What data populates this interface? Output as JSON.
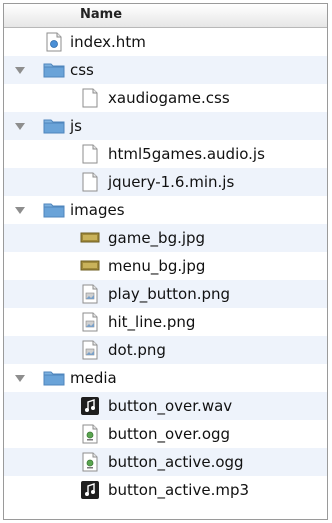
{
  "header": {
    "name_label": "Name"
  },
  "items": [
    {
      "label": "index.htm",
      "kind": "html",
      "level": 0,
      "expanded": false
    },
    {
      "label": "css",
      "kind": "folder",
      "level": 0,
      "expanded": true
    },
    {
      "label": "xaudiogame.css",
      "kind": "doc",
      "level": 1,
      "expanded": false
    },
    {
      "label": "js",
      "kind": "folder",
      "level": 0,
      "expanded": true
    },
    {
      "label": "html5games.audio.js",
      "kind": "doc",
      "level": 1,
      "expanded": false
    },
    {
      "label": "jquery-1.6.min.js",
      "kind": "doc",
      "level": 1,
      "expanded": false
    },
    {
      "label": "images",
      "kind": "folder",
      "level": 0,
      "expanded": true
    },
    {
      "label": "game_bg.jpg",
      "kind": "jpg",
      "level": 1,
      "expanded": false
    },
    {
      "label": "menu_bg.jpg",
      "kind": "jpg",
      "level": 1,
      "expanded": false
    },
    {
      "label": "play_button.png",
      "kind": "png",
      "level": 1,
      "expanded": false
    },
    {
      "label": "hit_line.png",
      "kind": "png",
      "level": 1,
      "expanded": false
    },
    {
      "label": "dot.png",
      "kind": "png",
      "level": 1,
      "expanded": false
    },
    {
      "label": "media",
      "kind": "folder",
      "level": 0,
      "expanded": true
    },
    {
      "label": "button_over.wav",
      "kind": "audio",
      "level": 1,
      "expanded": false
    },
    {
      "label": "button_over.ogg",
      "kind": "ogg",
      "level": 1,
      "expanded": false
    },
    {
      "label": "button_active.ogg",
      "kind": "ogg",
      "level": 1,
      "expanded": false
    },
    {
      "label": "button_active.mp3",
      "kind": "audio",
      "level": 1,
      "expanded": false
    }
  ],
  "colors": {
    "row_alt": "#eef3fb",
    "folder": "#6aa3d8"
  }
}
